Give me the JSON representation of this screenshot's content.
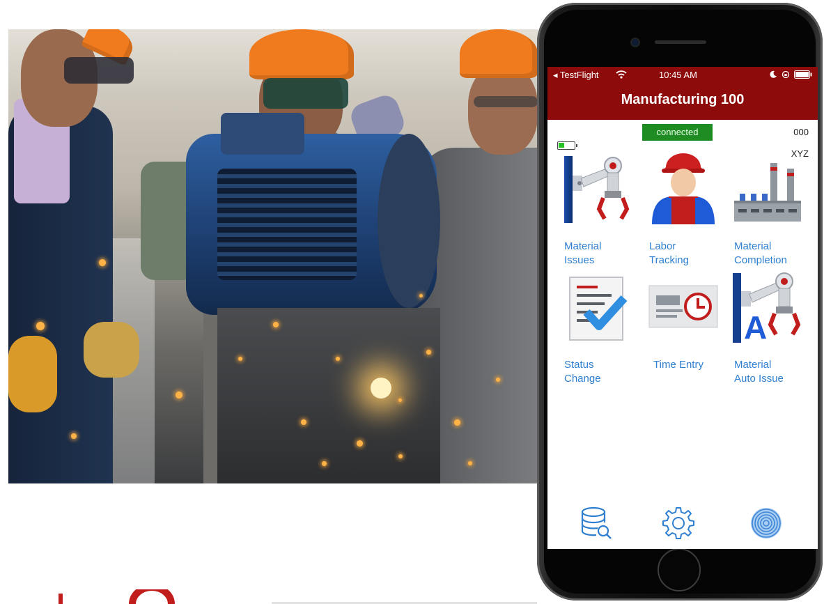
{
  "status_bar": {
    "carrier": "◂ TestFlight",
    "time": "10:45 AM"
  },
  "app": {
    "title": "Manufacturing 100",
    "connection_status": "connected",
    "code_top": "000",
    "code_bottom": "XYZ",
    "battery_level": 0.35
  },
  "tiles": [
    {
      "line1": "Material",
      "line2": "Issues",
      "icon": "robot-arm-icon"
    },
    {
      "line1": "Labor",
      "line2": "Tracking",
      "icon": "worker-icon"
    },
    {
      "line1": "Material",
      "line2": "Completion",
      "icon": "factory-icon"
    },
    {
      "line1": "Status",
      "line2": "Change",
      "icon": "checklist-icon"
    },
    {
      "line1": "Time Entry",
      "line2": "",
      "icon": "time-card-icon"
    },
    {
      "line1": "Material",
      "line2": "Auto Issue",
      "icon": "auto-robot-arm-icon"
    }
  ],
  "bottom_bar": [
    "database-search-icon",
    "settings-gear-icon",
    "fingerprint-icon"
  ],
  "colors": {
    "header": "#8e0b0b",
    "connected": "#1e8c23",
    "link": "#2f7fd0"
  }
}
